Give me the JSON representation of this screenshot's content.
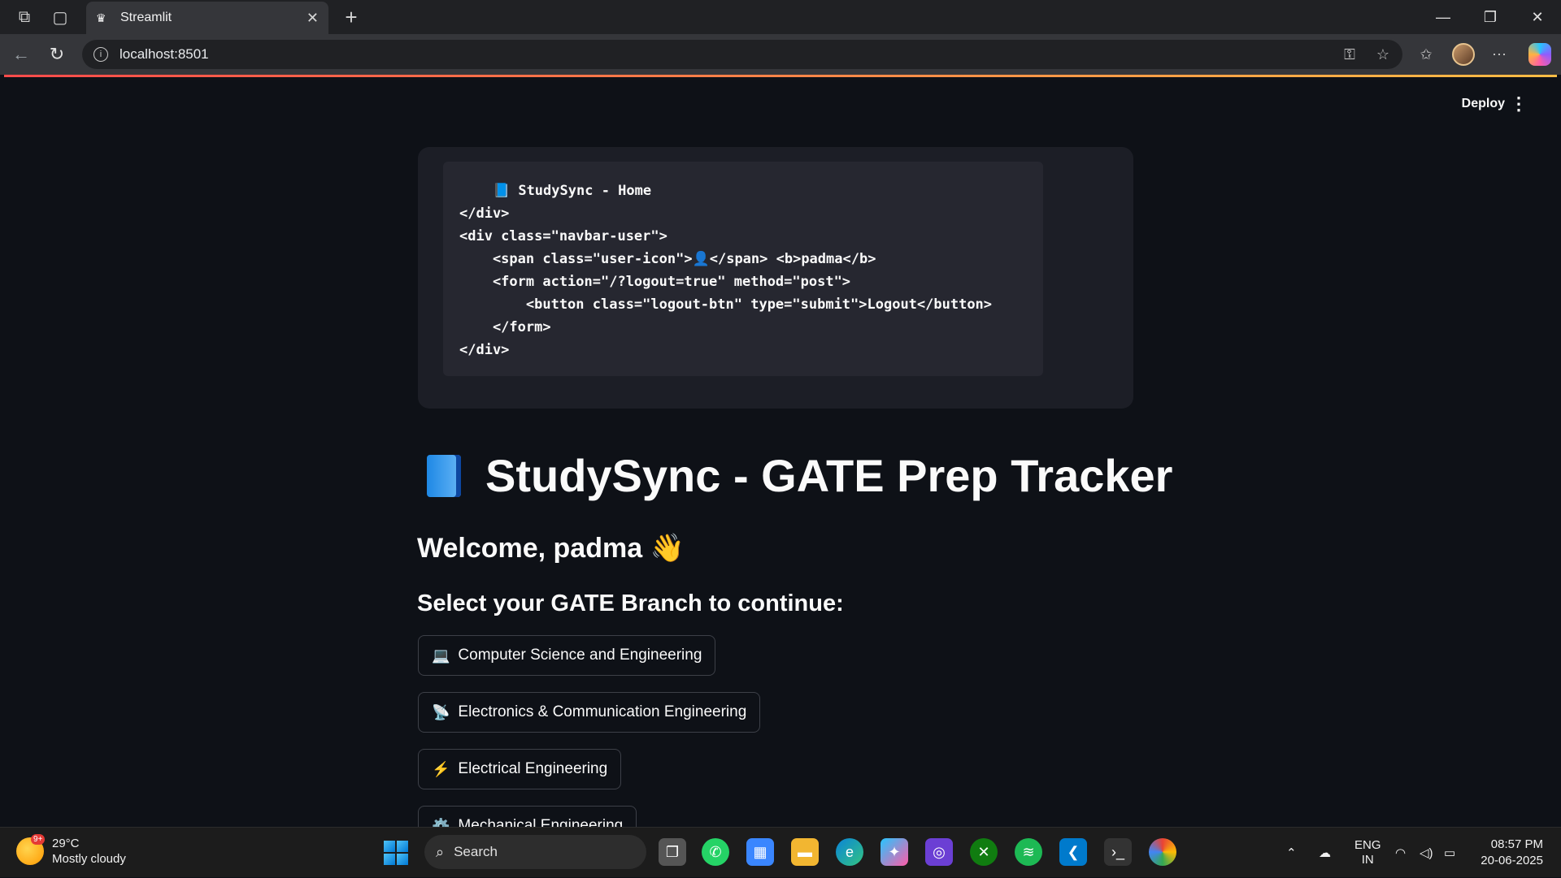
{
  "browser": {
    "tab_title": "Streamlit",
    "url": "localhost:8501",
    "new_tab_symbol": "+",
    "close_symbol": "✕"
  },
  "app": {
    "deploy_label": "Deploy",
    "code_block": "    📘 StudySync - Home\n</div>\n<div class=\"navbar-user\">\n    <span class=\"user-icon\">👤</span> <b>padma</b>\n    <form action=\"/?logout=true\" method=\"post\">\n        <button class=\"logout-btn\" type=\"submit\">Logout</button>\n    </form>\n</div>",
    "title": "StudySync - GATE Prep Tracker",
    "welcome": "Welcome, padma 👋",
    "select_prompt": "Select your GATE Branch to continue:",
    "branches": [
      {
        "icon": "💻",
        "label": "Computer Science and Engineering"
      },
      {
        "icon": "📡",
        "label": "Electronics & Communication Engineering"
      },
      {
        "icon": "⚡",
        "label": "Electrical Engineering"
      },
      {
        "icon": "⚙️",
        "label": "Mechanical Engineering"
      }
    ]
  },
  "taskbar": {
    "weather_badge": "9+",
    "temperature": "29°C",
    "weather_desc": "Mostly cloudy",
    "search_placeholder": "Search",
    "language_line1": "ENG",
    "language_line2": "IN",
    "time": "08:57 PM",
    "date": "20-06-2025"
  },
  "colors": {
    "background": "#0e1117",
    "accent_gradient_start": "#ff4b4b",
    "accent_gradient_end": "#ffbd45"
  }
}
